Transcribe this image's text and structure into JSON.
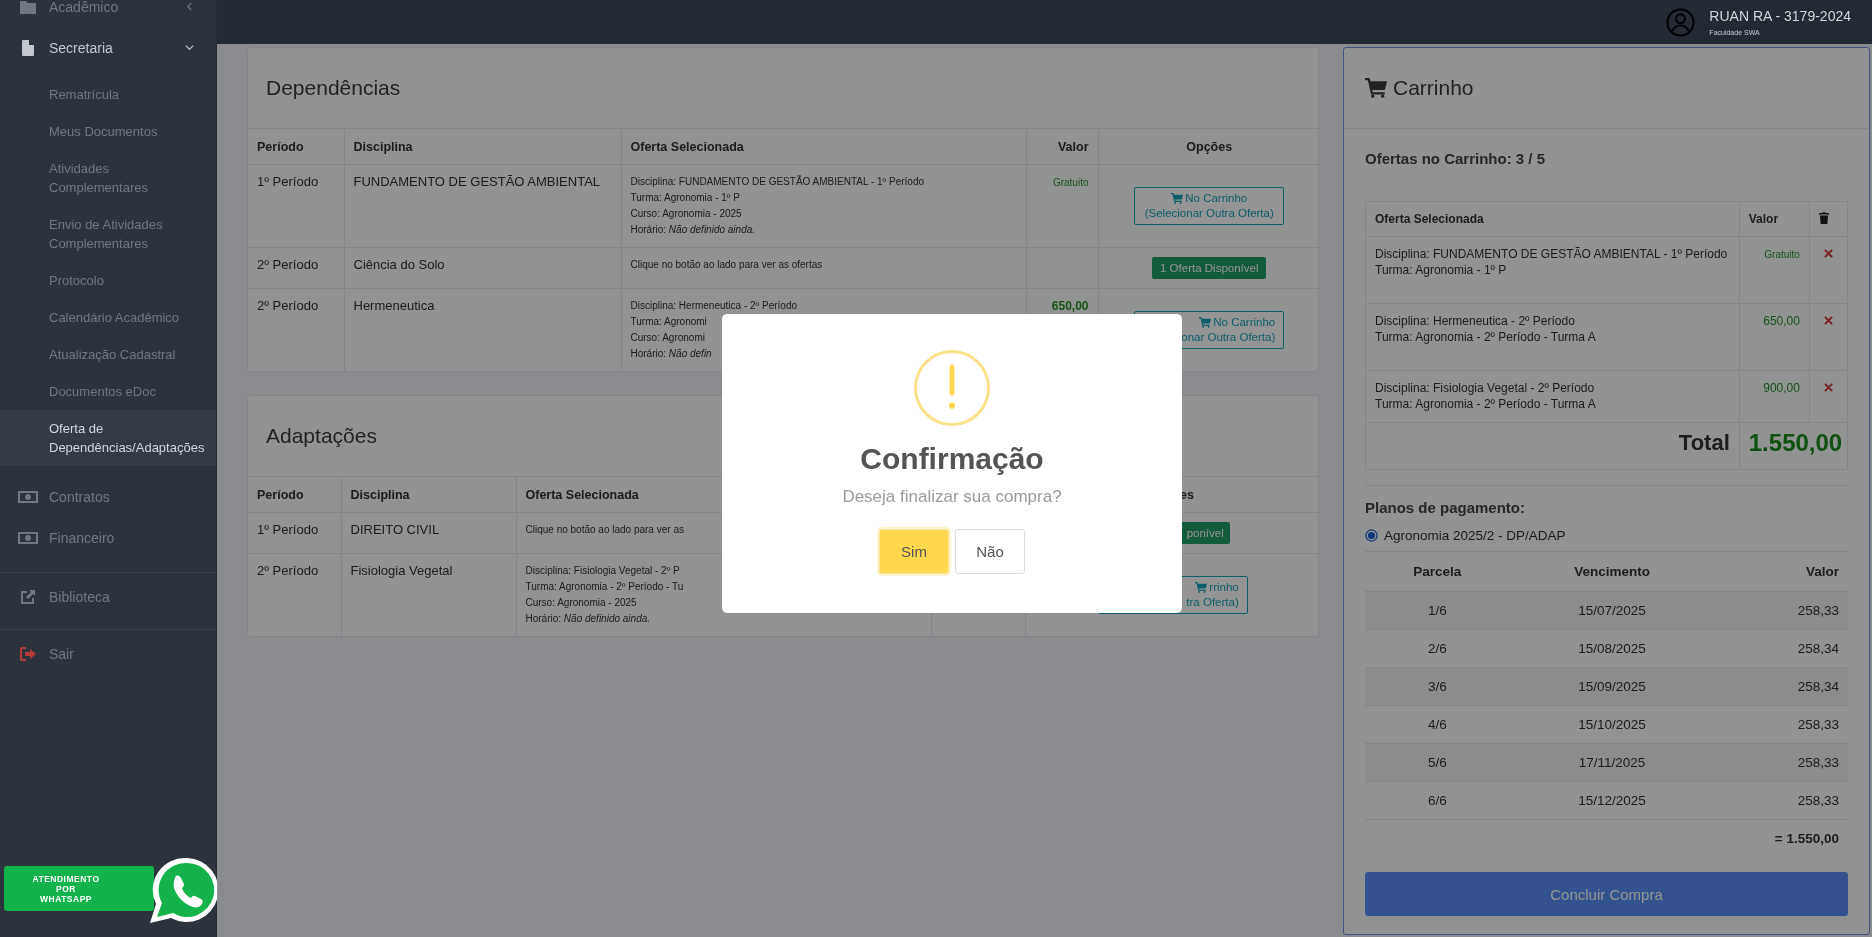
{
  "sidebar": {
    "items": [
      {
        "kind": "folder",
        "label": "Acadêmico",
        "expanded": false
      },
      {
        "kind": "document",
        "label": "Secretaria",
        "expanded": true,
        "children": [
          {
            "label": "Rematrícula",
            "selected": false
          },
          {
            "label": "Meus Documentos",
            "selected": false
          },
          {
            "label": "Atividades Complementares",
            "selected": false
          },
          {
            "label": "Envio de Atividades Complementares",
            "selected": false
          },
          {
            "label": "Protocolo",
            "selected": false
          },
          {
            "label": "Calendário Acadêmico",
            "selected": false
          },
          {
            "label": "Atualização Cadastral",
            "selected": false
          },
          {
            "label": "Documentos eDoc",
            "selected": false
          },
          {
            "label": "Oferta de Dependências/Adaptações",
            "selected": true
          }
        ]
      },
      {
        "kind": "money",
        "label": "Contratos"
      },
      {
        "kind": "money",
        "label": "Financeiro"
      },
      {
        "kind": "divider"
      },
      {
        "kind": "external",
        "label": "Biblioteca"
      },
      {
        "kind": "divider"
      },
      {
        "kind": "exit",
        "label": "Sair"
      }
    ]
  },
  "support_badge": {
    "label": "ATENDIMENTO POR WHATSAPP"
  },
  "header": {
    "user": "RUAN RA - 3179-2024",
    "institution": "Faculdade SWA"
  },
  "sections": [
    {
      "title": "Dependências",
      "columns": [
        "Período",
        "Disciplina",
        "Oferta Selecionada",
        "Valor",
        "Opções"
      ],
      "rows": [
        {
          "period": "1º Período",
          "discipline": "FUNDAMENTO DE GESTÃO AMBIENTAL",
          "offer": {
            "kind": "details",
            "lines": [
              "Disciplina: FUNDAMENTO DE GESTÃO AMBIENTAL - 1º Período",
              "Turma: Agronomia - 1º P",
              "Curso: Agronomia - 2025",
              "Horário: *Não definido ainda.*"
            ]
          },
          "value": {
            "kind": "free",
            "text": "Gratuito"
          },
          "option": {
            "kind": "cart",
            "lines": [
              "No Carrinho",
              "(Selecionar Outra Oferta)"
            ]
          }
        },
        {
          "period": "2º Período",
          "discipline": "Ciência do Solo",
          "offer": {
            "kind": "hint",
            "text": "Clique no botão ao lado para ver as ofertas"
          },
          "option": {
            "kind": "available",
            "lines": [
              "1 Oferta Disponível"
            ]
          }
        },
        {
          "period": "2º Período",
          "discipline": "Hermeneutica",
          "offer": {
            "kind": "details",
            "lines": [
              "Disciplina: Hermeneutica - 2º Período",
              "Turma: Agronomi",
              "Curso: Agronomi",
              "Horário: *Não defin*"
            ]
          },
          "value": {
            "kind": "price",
            "text": "650,00"
          },
          "option": {
            "kind": "cart",
            "lines": [
              "No Carrinho",
              "onar Outra Oferta)"
            ]
          }
        }
      ]
    },
    {
      "title": "Adaptações",
      "columns": [
        "Período",
        "Disciplina",
        "Oferta Selecionada",
        null,
        "es"
      ],
      "rows": [
        {
          "period": "1º Período",
          "discipline": "DIREITO CIVIL",
          "offer": {
            "kind": "hint",
            "text": "Clique no botão ao lado para ver as"
          },
          "option": {
            "kind": "available",
            "lines": [
              "ponível"
            ]
          }
        },
        {
          "period": "2º Período",
          "discipline": "Fisiologia Vegetal",
          "offer": {
            "kind": "details",
            "lines": [
              "Disciplina: Fisiologia Vegetal - 2º P",
              "Turma: Agronomia - 2º Período - Tu",
              "Curso: Agronomia - 2025",
              "Horário: *Não definido ainda.*"
            ]
          },
          "option": {
            "kind": "cart",
            "lines": [
              "rrinho",
              "tra Oferta)"
            ]
          }
        }
      ]
    }
  ],
  "cart": {
    "title": "Carrinho",
    "count_label": "Ofertas no Carrinho: 3 / 5",
    "columns": [
      "Oferta Selecionada",
      "Valor"
    ],
    "items": [
      {
        "lines": [
          "Disciplina: FUNDAMENTO DE GESTÃO AMBIENTAL - 1º Período",
          "Turma: Agronomia - 1º P"
        ],
        "value": {
          "kind": "free",
          "text": "Gratuito"
        }
      },
      {
        "lines": [
          "Disciplina: Hermeneutica - 2º Período",
          "Turma: Agronomia - 2º Período - Turma A"
        ],
        "value": {
          "kind": "price",
          "text": "650,00"
        }
      },
      {
        "lines": [
          "Disciplina: Fisiologia Vegetal - 2º Período",
          "Turma: Agronomia - 2º Período - Turma A"
        ],
        "value": {
          "kind": "price",
          "text": "900,00"
        }
      }
    ],
    "total_label": "Total",
    "total": "1.550,00"
  },
  "payment": {
    "title": "Planos de pagamento:",
    "plans": [
      {
        "label": "Agronomia 2025/2 - DP/ADAP",
        "selected": true
      }
    ],
    "columns": [
      "Parcela",
      "Vencimento",
      "Valor"
    ],
    "rows": [
      [
        "1/6",
        "15/07/2025",
        "258,33"
      ],
      [
        "2/6",
        "15/08/2025",
        "258,34"
      ],
      [
        "3/6",
        "15/09/2025",
        "258,34"
      ],
      [
        "4/6",
        "15/10/2025",
        "258,33"
      ],
      [
        "5/6",
        "17/11/2025",
        "258,33"
      ],
      [
        "6/6",
        "15/12/2025",
        "258,33"
      ]
    ],
    "total": "= 1.550,00",
    "submit": "Concluir Compra"
  },
  "modal": {
    "title": "Confirmação",
    "text": "Deseja finalizar sua compra?",
    "buttons": [
      {
        "kind": "confirm",
        "label": "Sim"
      },
      {
        "kind": "cancel",
        "label": "Não"
      }
    ]
  }
}
